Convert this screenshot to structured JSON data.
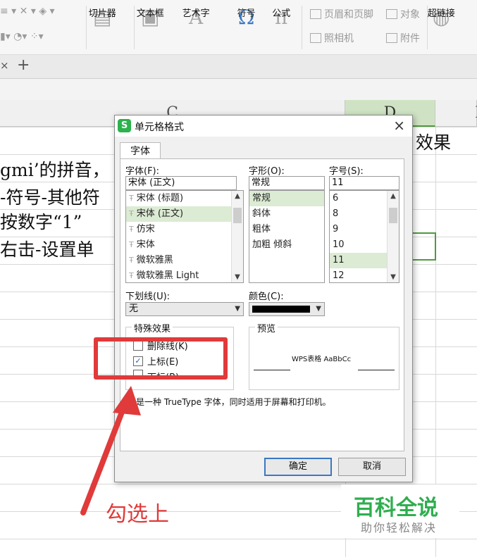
{
  "ribbon": {
    "slicer": "切片器",
    "textbox": "文本框",
    "arttext": "艺术字",
    "symbol": "符号",
    "formula": "公式",
    "header_footer": "页眉和页脚",
    "object": "对象",
    "camera": "照相机",
    "attachment": "附件",
    "hyperlink": "超链接",
    "glyph_art": "A",
    "glyph_symbol": "Ω",
    "glyph_formula": "π"
  },
  "tabs": {
    "close": "×",
    "add": "+"
  },
  "sheet": {
    "columns": [
      "C",
      "D",
      "E"
    ],
    "cells": {
      "d1": "效果",
      "row2": "gmi’的拼音，",
      "row3": "-符号-其他符",
      "row4": "按数字“1”",
      "row5": "右击-设置单"
    }
  },
  "dialog": {
    "title": "单元格格式",
    "close": "×",
    "tab": "字体",
    "font_label": "字体(F):",
    "font_value": "宋体 (正文)",
    "font_list": [
      "宋体 (标题)",
      "宋体 (正文)",
      "仿宋",
      "宋体",
      "微软雅黑",
      "微软雅黑 Light"
    ],
    "font_selected_index": 1,
    "style_label": "字形(O):",
    "style_value": "常规",
    "style_list": [
      "常规",
      "斜体",
      "粗体",
      "加粗 倾斜"
    ],
    "size_label": "字号(S):",
    "size_value": "11",
    "size_list": [
      "6",
      "8",
      "9",
      "10",
      "11",
      "12"
    ],
    "underline_label": "下划线(U):",
    "underline_value": "无",
    "color_label": "颜色(C):",
    "color_value": "#000000",
    "effects_title": "特殊效果",
    "strikethrough": "删除线(K)",
    "superscript": "上标(E)",
    "subscript": "下标(B)",
    "superscript_checked": true,
    "preview_title": "预览",
    "preview_text": "WPS表格  AaBbCc",
    "note": "这是一种 TrueType 字体，同时适用于屏幕和打印机。",
    "ok": "确定",
    "cancel": "取消"
  },
  "annotation": {
    "text": "勾选上",
    "color": "#e03a3a"
  },
  "watermark": {
    "main": "百科全说",
    "sub": "助你轻松解决",
    "color": "#2fae4f"
  }
}
